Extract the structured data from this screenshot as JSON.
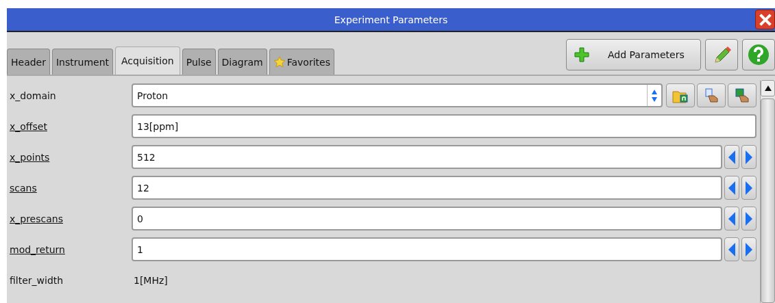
{
  "window": {
    "title": "Experiment Parameters"
  },
  "tabs": [
    {
      "label": "Header",
      "selected": false,
      "kind": "plain"
    },
    {
      "label": "Instrument",
      "selected": false,
      "kind": "plain"
    },
    {
      "label": "Acquisition",
      "selected": true,
      "kind": "plain"
    },
    {
      "label": "Pulse",
      "selected": false,
      "kind": "plain"
    },
    {
      "label": "Diagram",
      "selected": false,
      "kind": "plain"
    },
    {
      "label": "Favorites",
      "selected": false,
      "kind": "star"
    }
  ],
  "toolbar": {
    "add_button": "Add Parameters"
  },
  "parameters": [
    {
      "name": "x_domain",
      "linked": false,
      "kind": "select",
      "value": "Proton"
    },
    {
      "name": "x_offset",
      "linked": true,
      "kind": "text",
      "value": "13[ppm]"
    },
    {
      "name": "x_points",
      "linked": true,
      "kind": "spin",
      "value": "512"
    },
    {
      "name": "scans",
      "linked": true,
      "kind": "spin",
      "value": "12"
    },
    {
      "name": "x_prescans",
      "linked": true,
      "kind": "spin",
      "value": "0"
    },
    {
      "name": "mod_return",
      "linked": true,
      "kind": "spin",
      "value": "1"
    },
    {
      "name": "filter_width",
      "linked": false,
      "kind": "readonly",
      "value": "1[MHz]"
    }
  ]
}
